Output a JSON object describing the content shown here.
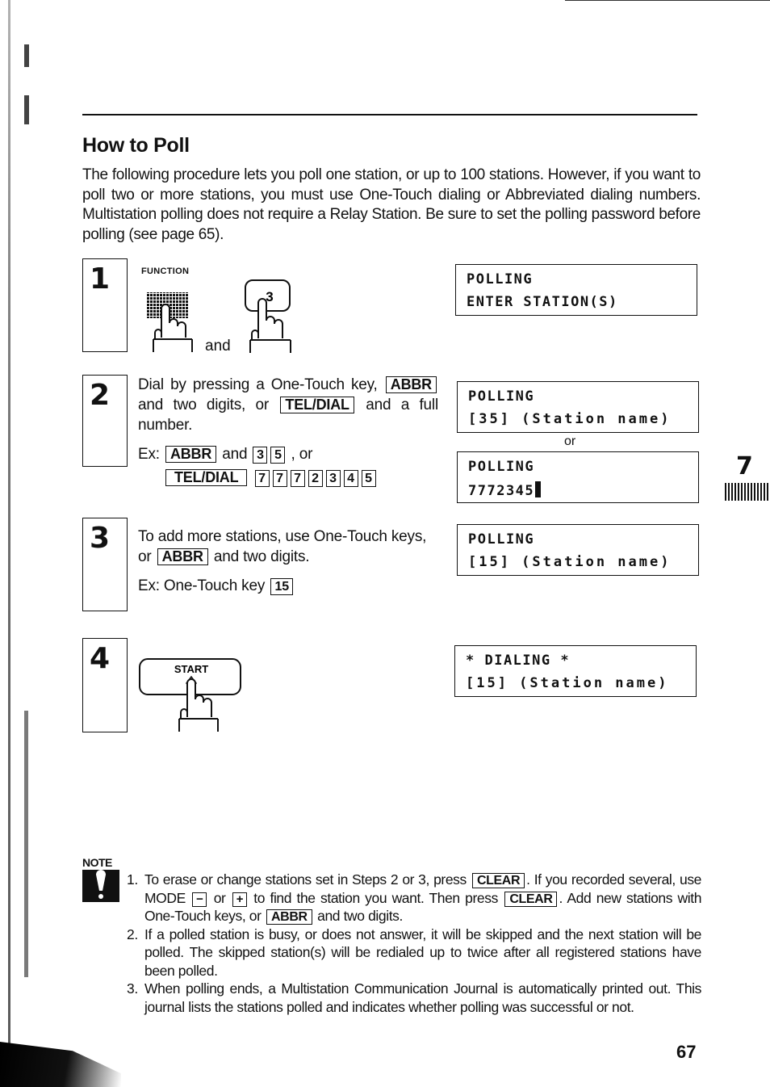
{
  "page": {
    "title": "How to Poll",
    "intro": "The following procedure lets you poll one station, or up to 100 stations. However, if you want to poll two or more stations, you must use One-Touch dialing or Abbreviated dialing numbers. Multistation polling does not require a Relay Station. Be sure to set the polling password before polling (see page 65).",
    "chapter_number": "7",
    "page_number": "67"
  },
  "steps": [
    {
      "number": "1",
      "function_label": "FUNCTION",
      "key_3": "3",
      "and": "and",
      "lcd": {
        "line1": "POLLING",
        "line2": "ENTER STATION(S)"
      }
    },
    {
      "number": "2",
      "text_a": "Dial by pressing a One-Touch key,",
      "key_abbr": "ABBR",
      "text_b": "and two digits, or",
      "key_tel": "TEL/DIAL",
      "text_c": "and a full number.",
      "ex_label": "Ex:",
      "ex_and": "and",
      "ex_or": ", or",
      "ex_abbr_digits": [
        "3",
        "5"
      ],
      "ex_tel_digits": [
        "7",
        "7",
        "7",
        "2",
        "3",
        "4",
        "5"
      ],
      "lcd_a": {
        "line1": "POLLING",
        "line2": "[35] (Station name)"
      },
      "or_label": "or",
      "lcd_b": {
        "line1": "POLLING",
        "line2": "7772345"
      }
    },
    {
      "number": "3",
      "text_a": "To add more stations, use One-Touch keys, or",
      "key_abbr": "ABBR",
      "text_b": "and two digits.",
      "ex_text": "Ex: One-Touch key",
      "ex_key": "15",
      "lcd": {
        "line1": "POLLING",
        "line2": "[15] (Station name)"
      }
    },
    {
      "number": "4",
      "start_label": "START",
      "lcd": {
        "line1": "* DIALING *",
        "line2": "[15] (Station name)"
      }
    }
  ],
  "note": {
    "label": "NOTE",
    "items": [
      {
        "n": "1.",
        "t1": "To erase or change stations set in Steps 2 or 3, press",
        "k_clear": "CLEAR",
        "t2": ". If you recorded several, use MODE",
        "k_minus": "−",
        "t3": "or",
        "k_plus": "+",
        "t4": "to find the station you want. Then press",
        "t5": ". Add new stations with One-Touch keys, or",
        "k_abbr": "ABBR",
        "t6": "and two digits."
      },
      {
        "n": "2.",
        "text": "If a polled station is busy, or does not answer, it will be skipped and the next station will be polled. The skipped station(s) will be redialed up to twice after all registered stations have been polled."
      },
      {
        "n": "3.",
        "text": "When polling ends, a Multistation Communication Journal is automatically printed out. This journal lists the stations polled and indicates whether polling was successful or not."
      }
    ]
  }
}
